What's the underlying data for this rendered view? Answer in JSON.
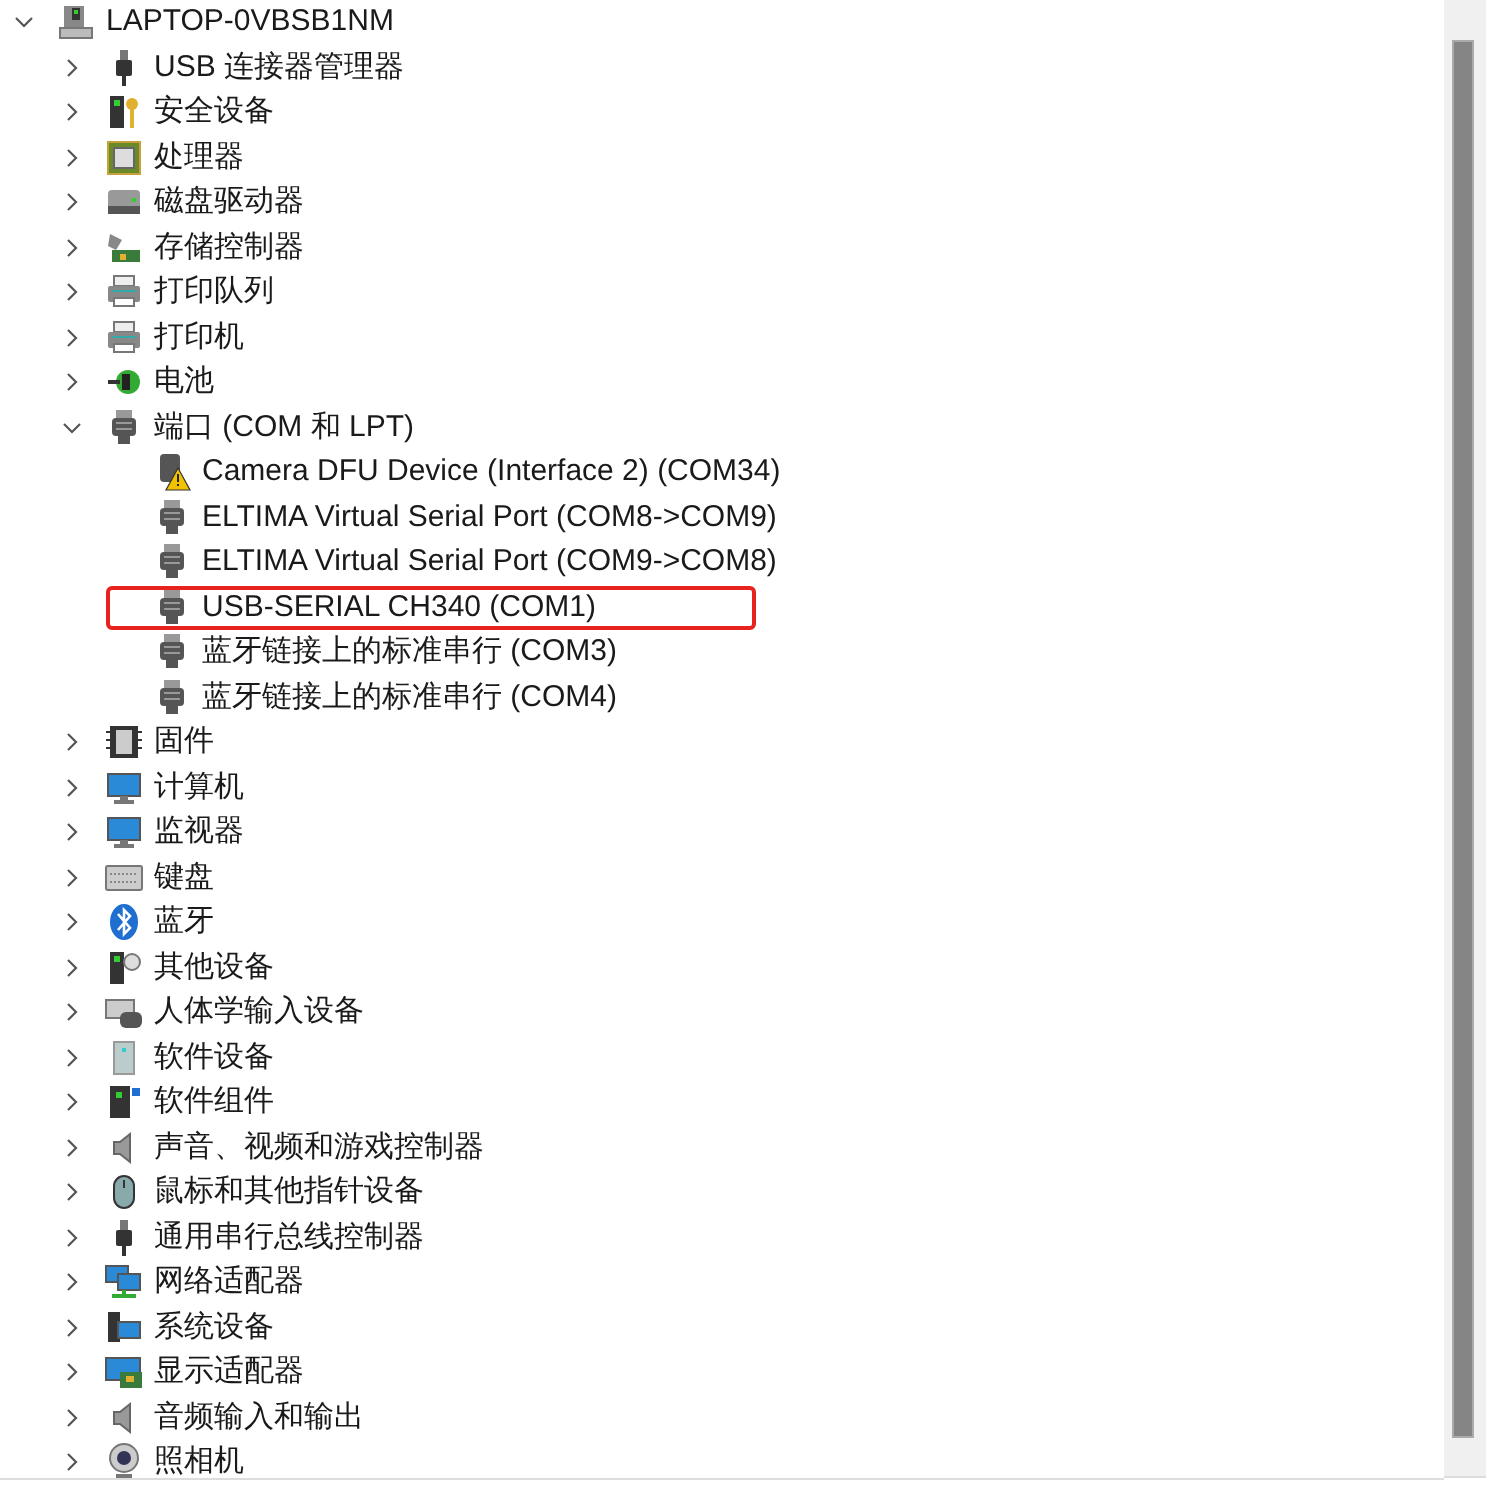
{
  "tree": {
    "label": "LAPTOP-0VBSB1NM",
    "kind": "computer",
    "expanded": true,
    "children": [
      {
        "label": "USB 连接器管理器",
        "kind": "usb",
        "expanded": false
      },
      {
        "label": "安全设备",
        "kind": "security",
        "expanded": false
      },
      {
        "label": "处理器",
        "kind": "cpu",
        "expanded": false
      },
      {
        "label": "磁盘驱动器",
        "kind": "disk",
        "expanded": false
      },
      {
        "label": "存储控制器",
        "kind": "storage",
        "expanded": false
      },
      {
        "label": "打印队列",
        "kind": "printer",
        "expanded": false
      },
      {
        "label": "打印机",
        "kind": "printer",
        "expanded": false
      },
      {
        "label": "电池",
        "kind": "battery",
        "expanded": false
      },
      {
        "label": "端口 (COM 和 LPT)",
        "kind": "port",
        "expanded": true,
        "children": [
          {
            "label": "Camera DFU Device (Interface 2) (COM34)",
            "kind": "warning",
            "highlighted": false
          },
          {
            "label": "ELTIMA Virtual Serial Port (COM8->COM9)",
            "kind": "port",
            "highlighted": false
          },
          {
            "label": "ELTIMA Virtual Serial Port (COM9->COM8)",
            "kind": "port",
            "highlighted": false
          },
          {
            "label": "USB-SERIAL CH340 (COM1)",
            "kind": "port",
            "highlighted": true
          },
          {
            "label": "蓝牙链接上的标准串行 (COM3)",
            "kind": "port",
            "highlighted": false
          },
          {
            "label": "蓝牙链接上的标准串行 (COM4)",
            "kind": "port",
            "highlighted": false
          }
        ]
      },
      {
        "label": "固件",
        "kind": "firmware",
        "expanded": false
      },
      {
        "label": "计算机",
        "kind": "monitor",
        "expanded": false
      },
      {
        "label": "监视器",
        "kind": "monitor",
        "expanded": false
      },
      {
        "label": "键盘",
        "kind": "keyboard",
        "expanded": false
      },
      {
        "label": "蓝牙",
        "kind": "bluetooth",
        "expanded": false
      },
      {
        "label": "其他设备",
        "kind": "other",
        "expanded": false
      },
      {
        "label": "人体学输入设备",
        "kind": "hid",
        "expanded": false
      },
      {
        "label": "软件设备",
        "kind": "software",
        "expanded": false
      },
      {
        "label": "软件组件",
        "kind": "component",
        "expanded": false
      },
      {
        "label": "声音、视频和游戏控制器",
        "kind": "speaker",
        "expanded": false
      },
      {
        "label": "鼠标和其他指针设备",
        "kind": "mouse",
        "expanded": false
      },
      {
        "label": "通用串行总线控制器",
        "kind": "usb",
        "expanded": false
      },
      {
        "label": "网络适配器",
        "kind": "network",
        "expanded": false
      },
      {
        "label": "系统设备",
        "kind": "system",
        "expanded": false
      },
      {
        "label": "显示适配器",
        "kind": "display",
        "expanded": false
      },
      {
        "label": "音频输入和输出",
        "kind": "speaker",
        "expanded": false
      },
      {
        "label": "照相机",
        "kind": "camera",
        "expanded": false
      }
    ]
  }
}
